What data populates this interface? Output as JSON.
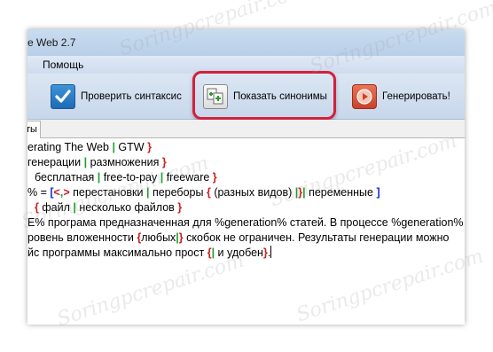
{
  "titlebar": {
    "title": "e Web 2.7"
  },
  "menu": {
    "help": "Помощь"
  },
  "toolbar": {
    "check": "Проверить синтаксис",
    "synonyms": "Показать синонимы",
    "generate": "Генерировать!"
  },
  "tabs": {
    "active": "ты"
  },
  "watermark": "Soringpcrepair.com",
  "editor": {
    "line1": {
      "a": "erating The Web ",
      "b": "| ",
      "c": "GTW ",
      "d": "}"
    },
    "line2": {
      "a": "генерации ",
      "b": "| ",
      "c": "размножения ",
      "d": "}"
    },
    "line3": {
      "a": "бесплатная ",
      "b": "| ",
      "c": "free-to-pay ",
      "d": "| ",
      "e": "freeware ",
      "f": "}"
    },
    "line4": {
      "a": "% = ",
      "b": "[",
      "c": "<",
      "d": ",",
      "e": ">",
      "f": " перестановки ",
      "g": "| ",
      "h": "переборы ",
      "i": "{",
      "j": " (разных видов) ",
      "k": "|",
      "l": "}",
      "m": "|",
      "n": " переменные ",
      "o": "]"
    },
    "line5": {
      "a": "{",
      "b": " файл ",
      "c": "| ",
      "d": "несколько  файлов ",
      "e": "}"
    },
    "line6": {
      "a": "E% програма предназначенная для %generation% статей. В процессе %generation%"
    },
    "line7": {
      "a": "ровень вложенности ",
      "b": "{",
      "c": "любых",
      "d": "|",
      "e": "}",
      "f": " скобок не ограничен. Результаты генерации можно"
    },
    "line8": {
      "a": "йс программы максимально прост ",
      "b": "{",
      "c": "|",
      "d": " и удобен",
      "e": "}",
      "f": "."
    }
  },
  "colors": {
    "brace": "#d11a1a",
    "pipe": "#1aa12a",
    "bracket": "#1a2fd1",
    "highlight": "#d3203b"
  }
}
